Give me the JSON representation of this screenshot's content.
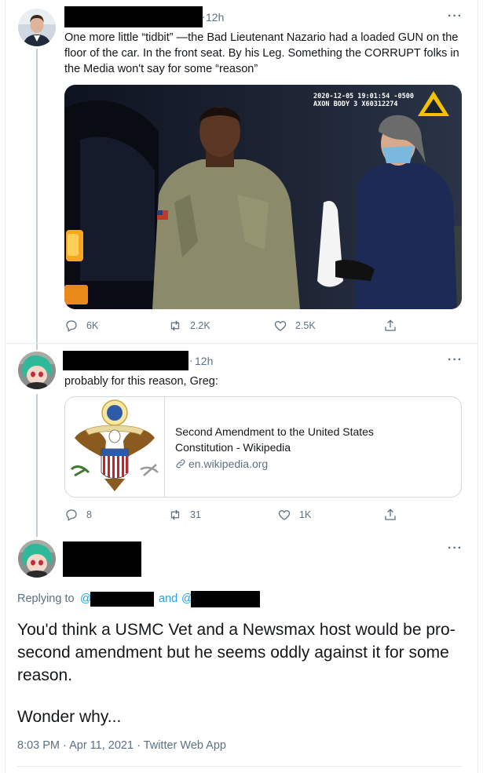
{
  "tweet1": {
    "time": "12h",
    "more": "···",
    "text": "One more little “tidbit” —the Bad Lieutenant Nazario had a loaded GUN on the floor of the car.  In the front seat. By his Leg. Something the CORRUPT folks in the Media won't say for some “reason”",
    "media": {
      "overlay_line1": "2020-12-05 19:01:54 -0500",
      "overlay_line2": "AXON BODY 3 X60312274"
    },
    "replies": "6K",
    "retweets": "2.2K",
    "likes": "2.5K"
  },
  "tweet2": {
    "time": "12h",
    "more": "···",
    "text": "probably for this reason, Greg:",
    "card": {
      "title": "Second Amendment to the United States Constitution - Wikipedia",
      "domain": "en.wikipedia.org"
    },
    "replies": "8",
    "retweets": "31",
    "likes": "1K"
  },
  "tweet3": {
    "more": "···",
    "replying_to_prefix": "Replying to",
    "at1": "@",
    "and_text": "and",
    "at2": "@",
    "text_line1": "You'd think a USMC Vet and a Newsmax host would be pro-second amendment but he seems oddly against it for some reason.",
    "text_line2": "Wonder why...",
    "meta": "8:03 PM · Apr 11, 2021 · Twitter Web App"
  },
  "colors": {
    "accent": "#1da1f2",
    "secondary_text": "#5b7083",
    "border": "#e6ecf0"
  }
}
